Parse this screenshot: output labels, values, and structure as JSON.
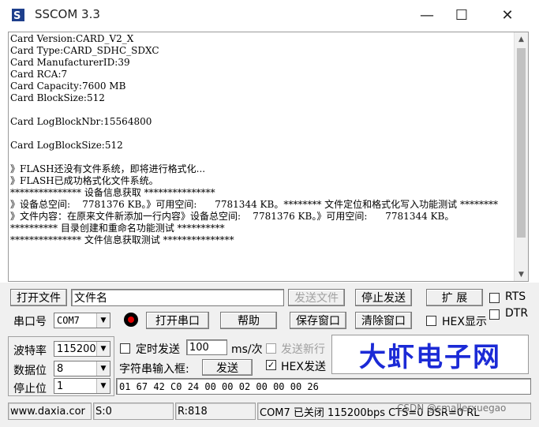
{
  "window": {
    "title": "SSCOM 3.3",
    "controls": {
      "minimize": "—",
      "maximize": "☐",
      "close": "✕"
    }
  },
  "terminal": {
    "text": "Card Version:CARD_V2_X\nCard Type:CARD_SDHC_SDXC\nCard ManufacturerID:39\nCard RCA:7\nCard Capacity:7600 MB\nCard BlockSize:512\n\nCard LogBlockNbr:15564800\n\nCard LogBlockSize:512\n\n》FLASH还没有文件系统，即将进行格式化...\n》FLASH已成功格式化文件系统。\n*************** 设备信息获取 ***************\n》设备总空间:    7781376 KB。》可用空间:      7781344 KB。******** 文件定位和格式化写入功能测试 ********\n》文件内容：在原来文件新添加一行内容》设备总空间:    7781376 KB。》可用空间:      7781344 KB。\n********** 目录创建和重命名功能测试 **********\n*************** 文件信息获取测试 ***************"
  },
  "row1": {
    "open_file_button": "打开文件",
    "file_name_value": "文件名",
    "send_file_button": "发送文件",
    "stop_send_button": "停止发送",
    "expand_button": "扩 展",
    "rts_label": "RTS"
  },
  "row2": {
    "port_label": "串口号",
    "port_value": "COM7",
    "open_port_button": "打开串口",
    "help_button": "帮助",
    "save_window_button": "保存窗口",
    "clear_window_button": "清除窗口",
    "hex_display_label": "HEX显示",
    "dtr_label": "DTR"
  },
  "row3": {
    "baud_label": "波特率",
    "baud_value": "115200",
    "timed_send_label": "定时发送",
    "interval_value": "100",
    "interval_unit": "ms/次",
    "send_newline_label": "发送新行"
  },
  "row4": {
    "data_bits_label": "数据位",
    "data_bits_value": "8",
    "string_input_label": "字符串输入框:",
    "send_button": "发送",
    "hex_send_label": "HEX发送",
    "hex_send_checked": "✓"
  },
  "row5": {
    "stop_bits_label": "停止位",
    "stop_bits_value": "1",
    "send_data_value": "01 67 42 C0 24 00 00 02 00 00 00 26"
  },
  "brand": {
    "text": "大虾电子网"
  },
  "status": {
    "website": "www.daxia.cor",
    "sent": "S:0",
    "received": "R:818",
    "port_state": "COM7 已关闭  115200bps  CTS=0 DSR=0 RL",
    "watermark": "CSDN @smallerxuegao"
  },
  "colors": {
    "brand_blue": "#1b2ad6",
    "record_red": "#e00000"
  }
}
